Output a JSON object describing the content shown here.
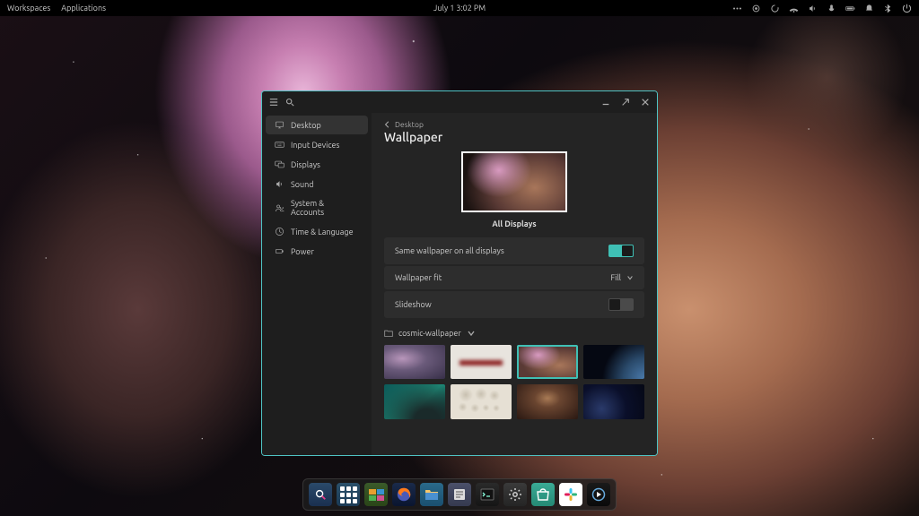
{
  "topbar": {
    "workspaces": "Workspaces",
    "applications": "Applications",
    "datetime": "July 1 3:02 PM"
  },
  "window": {
    "breadcrumb": "Desktop",
    "title": "Wallpaper",
    "section_label": "All Displays",
    "rows": {
      "same_all": "Same wallpaper on all displays",
      "fit_label": "Wallpaper fit",
      "fit_value": "Fill",
      "slideshow": "Slideshow"
    },
    "folder": "cosmic-wallpaper"
  },
  "sidebar": {
    "items": [
      {
        "label": "Desktop"
      },
      {
        "label": "Input Devices"
      },
      {
        "label": "Displays"
      },
      {
        "label": "Sound"
      },
      {
        "label": "System & Accounts"
      },
      {
        "label": "Time & Language"
      },
      {
        "label": "Power"
      }
    ]
  },
  "toggles": {
    "same_wallpaper": true,
    "slideshow": false
  },
  "wallpapers": {
    "selected_index": 2,
    "count": 8
  },
  "dock": {
    "items": [
      "search",
      "launcher",
      "workspaces",
      "firefox",
      "files",
      "editor",
      "terminal",
      "settings",
      "pop-shop",
      "slack",
      "media"
    ]
  },
  "colors": {
    "accent": "#3fc0b5"
  }
}
